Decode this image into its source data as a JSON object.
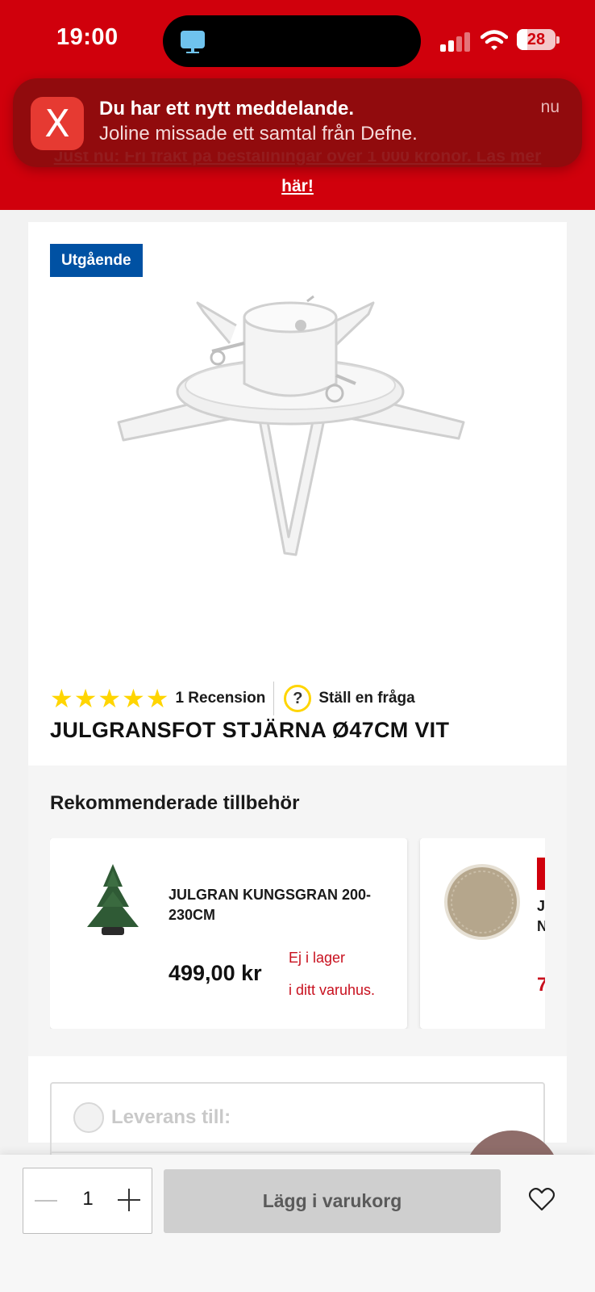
{
  "status_bar": {
    "time": "19:00",
    "battery": "28",
    "battery_level": 0.28
  },
  "promo": {
    "line1": "Just nu: Fri frakt på beställningar över 1 000 kronor. Läs mer",
    "line2": "här!"
  },
  "notification": {
    "app_icon": "x-app-icon",
    "title": "Du har ett nytt meddelande.",
    "body": "Joline missade ett samtal från Defne.",
    "time": "nu"
  },
  "product": {
    "badge": "Utgående",
    "rating": 5,
    "review_count": "1 Recension",
    "ask_question": "Ställ en fråga",
    "title": "JULGRANSFOT STJÄRNA Ø47CM VIT"
  },
  "accessories": {
    "heading": "Rekommenderade tillbehör",
    "items": [
      {
        "name": "JULGRAN KUNGSGRAN 200-230CM",
        "price": "499,00 kr",
        "stock_line1": "Ej i lager",
        "stock_line2": "i ditt varuhus."
      },
      {
        "name_part1": "J",
        "name_part2": "N",
        "price_part": "7"
      }
    ]
  },
  "delivery": {
    "label": "Leverans till:"
  },
  "bottom_bar": {
    "quantity": "1",
    "add_to_cart": "Lägg i varukorg"
  },
  "colors": {
    "brand_red": "#d0000c",
    "badge_blue": "#0051a3",
    "star_yellow": "#ffd500",
    "stock_red": "#c8101e"
  }
}
